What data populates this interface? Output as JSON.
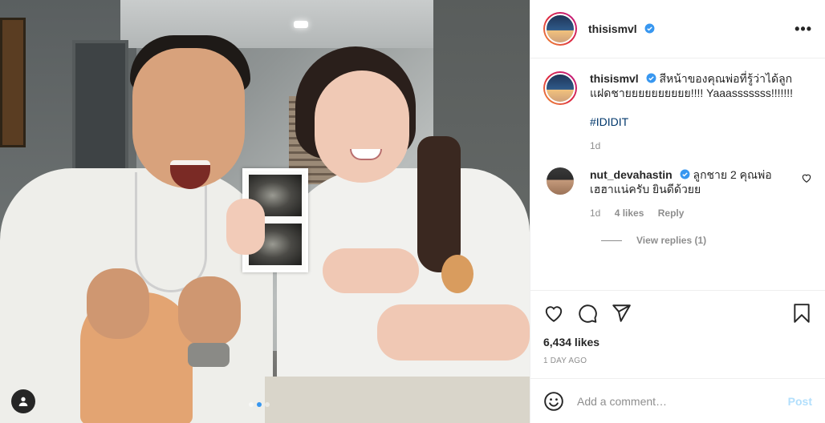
{
  "post": {
    "author": "thisismvl",
    "more_label": "•••",
    "carousel_dots": 3,
    "carousel_active": 2
  },
  "caption": {
    "username": "thisismvl",
    "text": "สีหน้าของคุณพ่อที่รู้ว่าได้ลูกแฝดชายยยยยยยยยย!!!! Yaaasssssss!!!!!!!",
    "hashtag": "#IDIDIT",
    "time": "1d"
  },
  "comment": {
    "username": "nut_devahastin",
    "text": "ลูกชาย 2 คุณพ่อเฮฮาแน่ครับ ยินดีด้วยย",
    "time": "1d",
    "likes": "4 likes",
    "reply_label": "Reply",
    "view_replies": "View replies (1)"
  },
  "actions": {
    "likes": "6,434 likes",
    "posted_ago": "1 DAY AGO"
  },
  "composer": {
    "placeholder": "Add a comment…",
    "post_label": "Post"
  },
  "colors": {
    "verified": "#3897f0",
    "link": "#00376b",
    "post_disabled": "#b2dffc",
    "muted": "#8e8e8e"
  },
  "icons": [
    "user-tag-icon",
    "more-icon",
    "verified-icon",
    "heart-icon",
    "comment-icon",
    "share-icon",
    "bookmark-icon",
    "emoji-icon"
  ]
}
